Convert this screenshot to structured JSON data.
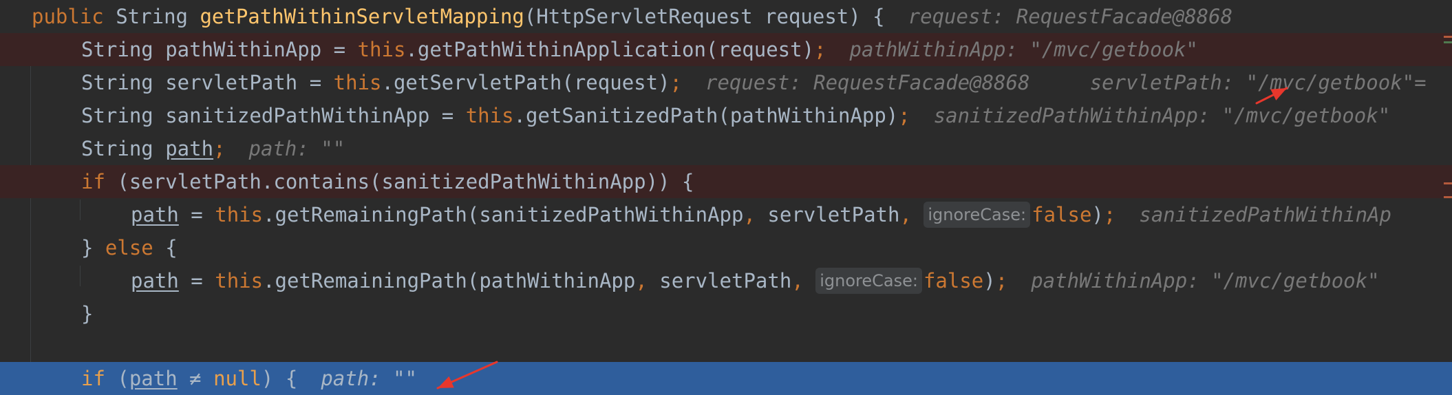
{
  "editor": {
    "lines": [
      {
        "line_id": "method-signature",
        "kind": "normal",
        "parts": [
          {
            "t": "public",
            "c": "kw"
          },
          {
            "t": " String ",
            "c": ""
          },
          {
            "t": "getPathWithinServletMapping",
            "c": "mth"
          },
          {
            "t": "(HttpServletRequest request) {",
            "c": ""
          }
        ],
        "hint": "request: RequestFacade@8868"
      },
      {
        "line_id": "path-within-app",
        "kind": "breakpoint",
        "parts": [
          {
            "t": "String pathWithinApp = ",
            "c": ""
          },
          {
            "t": "this",
            "c": "kw"
          },
          {
            "t": ".getPathWithinApplication(request)",
            "c": ""
          },
          {
            "t": ";",
            "c": "kw"
          }
        ],
        "hint": "pathWithinApp: \"/mvc/getbook\""
      },
      {
        "line_id": "servlet-path",
        "kind": "normal",
        "parts": [
          {
            "t": "String servletPath = ",
            "c": ""
          },
          {
            "t": "this",
            "c": "kw"
          },
          {
            "t": ".getServletPath(request)",
            "c": ""
          },
          {
            "t": ";",
            "c": "kw"
          }
        ],
        "hint": "request: RequestFacade@8868     servletPath: \"/mvc/getbook\"="
      },
      {
        "line_id": "sanitized-path",
        "kind": "normal",
        "parts": [
          {
            "t": "String sanitizedPathWithinApp = ",
            "c": ""
          },
          {
            "t": "this",
            "c": "kw"
          },
          {
            "t": ".getSanitizedPath(pathWithinApp)",
            "c": ""
          },
          {
            "t": ";",
            "c": "kw"
          }
        ],
        "hint": "sanitizedPathWithinApp: \"/mvc/getbook\""
      },
      {
        "line_id": "path-declaration",
        "kind": "normal",
        "parts": [
          {
            "t": "String ",
            "c": ""
          },
          {
            "t": "path",
            "c": "ul"
          },
          {
            "t": ";",
            "c": "kw"
          }
        ],
        "hint": "path: \"\""
      },
      {
        "line_id": "if-contains",
        "kind": "breakpoint",
        "parts": [
          {
            "t": "if",
            "c": "kw"
          },
          {
            "t": " (servletPath.contains(sanitizedPathWithinApp)) {",
            "c": ""
          }
        ],
        "hint": ""
      },
      {
        "line_id": "path-assign-sanitized",
        "kind": "normal",
        "parts": [
          {
            "t": "path",
            "c": "ul"
          },
          {
            "t": " = ",
            "c": ""
          },
          {
            "t": "this",
            "c": "kw"
          },
          {
            "t": ".getRemainingPath(sanitizedPathWithinApp",
            "c": ""
          },
          {
            "t": ",",
            "c": "kw"
          },
          {
            "t": " servletPath",
            "c": ""
          },
          {
            "t": ", ",
            "c": "kw"
          },
          {
            "t": "ignoreCase:",
            "c": "pill"
          },
          {
            "t": "false",
            "c": "kw"
          },
          {
            "t": ")",
            "c": ""
          },
          {
            "t": ";",
            "c": "kw"
          }
        ],
        "hint": "sanitizedPathWithinAp"
      },
      {
        "line_id": "else-branch",
        "kind": "normal",
        "parts": [
          {
            "t": "} ",
            "c": ""
          },
          {
            "t": "else",
            "c": "kw"
          },
          {
            "t": " {",
            "c": ""
          }
        ],
        "hint": ""
      },
      {
        "line_id": "path-assign-app",
        "kind": "normal",
        "parts": [
          {
            "t": "path",
            "c": "ul"
          },
          {
            "t": " = ",
            "c": ""
          },
          {
            "t": "this",
            "c": "kw"
          },
          {
            "t": ".getRemainingPath(pathWithinApp",
            "c": ""
          },
          {
            "t": ",",
            "c": "kw"
          },
          {
            "t": " servletPath",
            "c": ""
          },
          {
            "t": ", ",
            "c": "kw"
          },
          {
            "t": "ignoreCase:",
            "c": "pill"
          },
          {
            "t": "false",
            "c": "kw"
          },
          {
            "t": ")",
            "c": ""
          },
          {
            "t": ";",
            "c": "kw"
          }
        ],
        "hint": "pathWithinApp: \"/mvc/getbook\""
      },
      {
        "line_id": "close-brace",
        "kind": "normal",
        "parts": [
          {
            "t": "}",
            "c": ""
          }
        ],
        "hint": ""
      },
      {
        "line_id": "blank",
        "kind": "normal",
        "parts": [],
        "hint": ""
      },
      {
        "line_id": "if-path-not-null",
        "kind": "current",
        "parts": [
          {
            "t": "if",
            "c": "kw"
          },
          {
            "t": " (",
            "c": ""
          },
          {
            "t": "path",
            "c": "ul"
          },
          {
            "t": " ≠ ",
            "c": ""
          },
          {
            "t": "null",
            "c": "kw"
          },
          {
            "t": ") {",
            "c": ""
          }
        ],
        "hint": "path: \"\""
      }
    ]
  },
  "colors": {
    "background": "#2b2b2b",
    "keyword": "#cc7832",
    "method": "#ffc66d",
    "inlay_hint": "#787878",
    "breakpoint_line": "#3a2323",
    "execution_line": "#2f5e9c",
    "annotation_arrow": "#e8372c"
  }
}
